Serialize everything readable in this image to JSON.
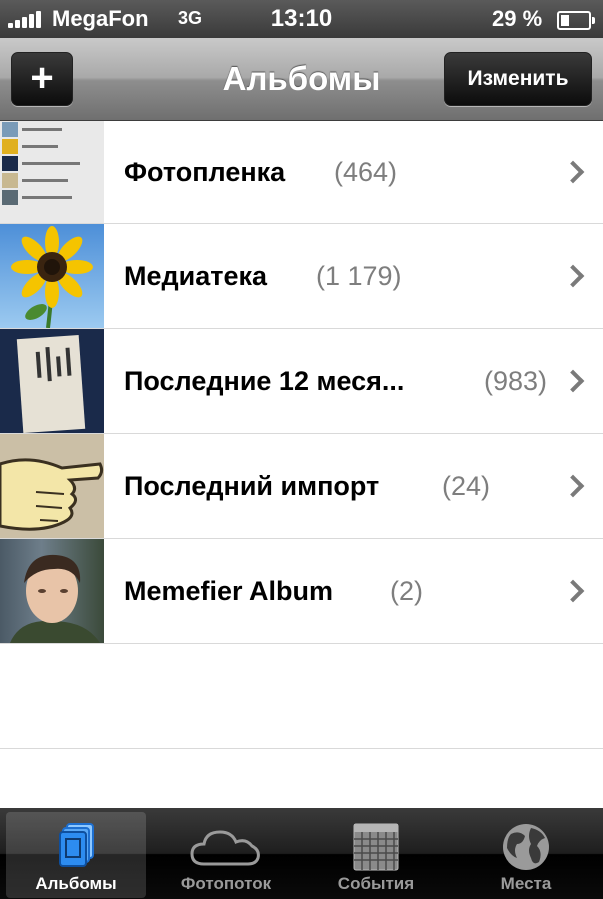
{
  "status_bar": {
    "carrier": "MegaFon",
    "network": "3G",
    "time": "13:10",
    "battery_percent": "29 %",
    "battery_level": 0.29
  },
  "navbar": {
    "add_label": "+",
    "title": "Альбомы",
    "edit_label": "Изменить"
  },
  "albums": [
    {
      "title": "Фотопленка",
      "count": "(464)"
    },
    {
      "title": "Медиатека",
      "count": "(1 179)"
    },
    {
      "title": "Последние 12 меся...",
      "count": "(983)"
    },
    {
      "title": "Последний импорт",
      "count": "(24)"
    },
    {
      "title": "Memefier Album",
      "count": "(2)"
    }
  ],
  "tabbar": {
    "tabs": [
      {
        "label": "Альбомы",
        "icon": "albums-icon",
        "active": true
      },
      {
        "label": "Фотопоток",
        "icon": "cloud-icon",
        "active": false
      },
      {
        "label": "События",
        "icon": "calendar-icon",
        "active": false
      },
      {
        "label": "Места",
        "icon": "globe-icon",
        "active": false
      }
    ]
  },
  "colors": {
    "tab_active": "#2d8cf0",
    "count_gray": "#7e7e7e"
  }
}
